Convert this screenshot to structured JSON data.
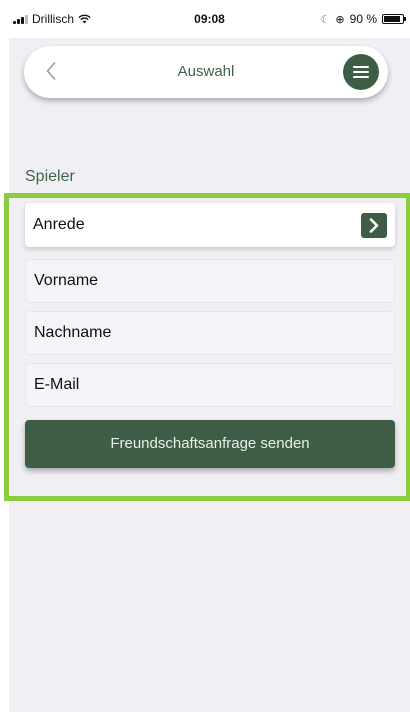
{
  "status_bar": {
    "carrier": "Drillisch",
    "time": "09:08",
    "battery_text": "90 %",
    "battery_level": 0.9,
    "icons": [
      "signal-icon",
      "wifi-icon",
      "moon-icon",
      "rotation-lock-icon",
      "battery-icon"
    ]
  },
  "header": {
    "title": "Auswahl",
    "back_icon": "back-chevron-icon",
    "menu_icon": "hamburger-menu-icon"
  },
  "form": {
    "section_title": "Spieler",
    "salutation_label": "Anrede",
    "salutation_icon": "chevron-right-icon",
    "first_name_placeholder": "Vorname",
    "last_name_placeholder": "Nachname",
    "email_placeholder": "E-Mail",
    "submit_label": "Freundschaftsanfrage senden"
  },
  "colors": {
    "brand_green": "#3d5e45",
    "highlight_green": "#8bcd3e",
    "background": "#efeff4"
  }
}
